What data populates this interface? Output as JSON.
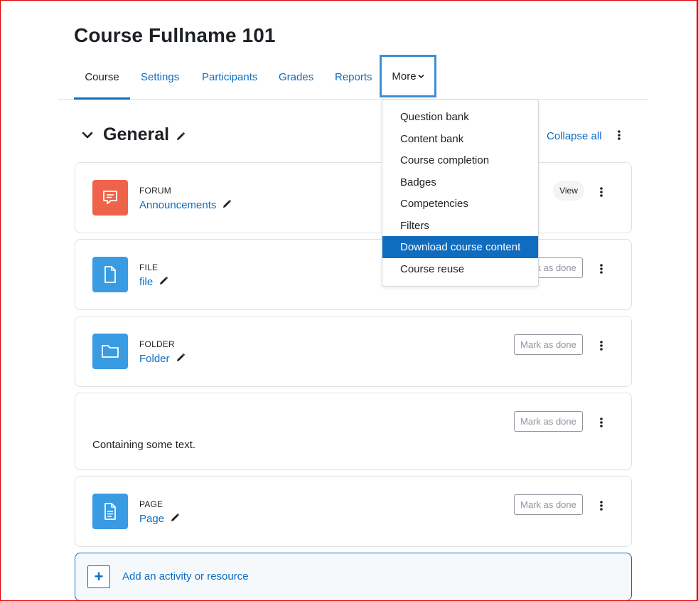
{
  "page": {
    "title": "Course Fullname 101"
  },
  "nav": {
    "tabs": [
      "Course",
      "Settings",
      "Participants",
      "Grades",
      "Reports"
    ],
    "more_label": "More",
    "active": "Course"
  },
  "section": {
    "title": "General",
    "collapse_all": "Collapse all"
  },
  "more_menu": {
    "items": [
      "Question bank",
      "Content bank",
      "Course completion",
      "Badges",
      "Competencies",
      "Filters",
      "Download course content",
      "Course reuse"
    ],
    "highlighted": "Download course content"
  },
  "activities": [
    {
      "type": "FORUM",
      "name": "Announcements",
      "button": "View",
      "icon": "forum-icon"
    },
    {
      "type": "FILE",
      "name": "file",
      "button": "Mark as done",
      "icon": "file-icon"
    },
    {
      "type": "FOLDER",
      "name": "Folder",
      "button": "Mark as done",
      "icon": "folder-icon"
    },
    {
      "text": "Containing some text.",
      "button": "Mark as done"
    },
    {
      "type": "PAGE",
      "name": "Page",
      "button": "Mark as done",
      "icon": "page-icon"
    }
  ],
  "add_activity": {
    "label": "Add an activity or resource"
  },
  "colors": {
    "link": "#0f6cbf",
    "forum_icon_bg": "#f0634b",
    "resource_icon_bg": "#399be2",
    "menu_highlight": "#0f6cbf",
    "frame": "#e00000"
  }
}
